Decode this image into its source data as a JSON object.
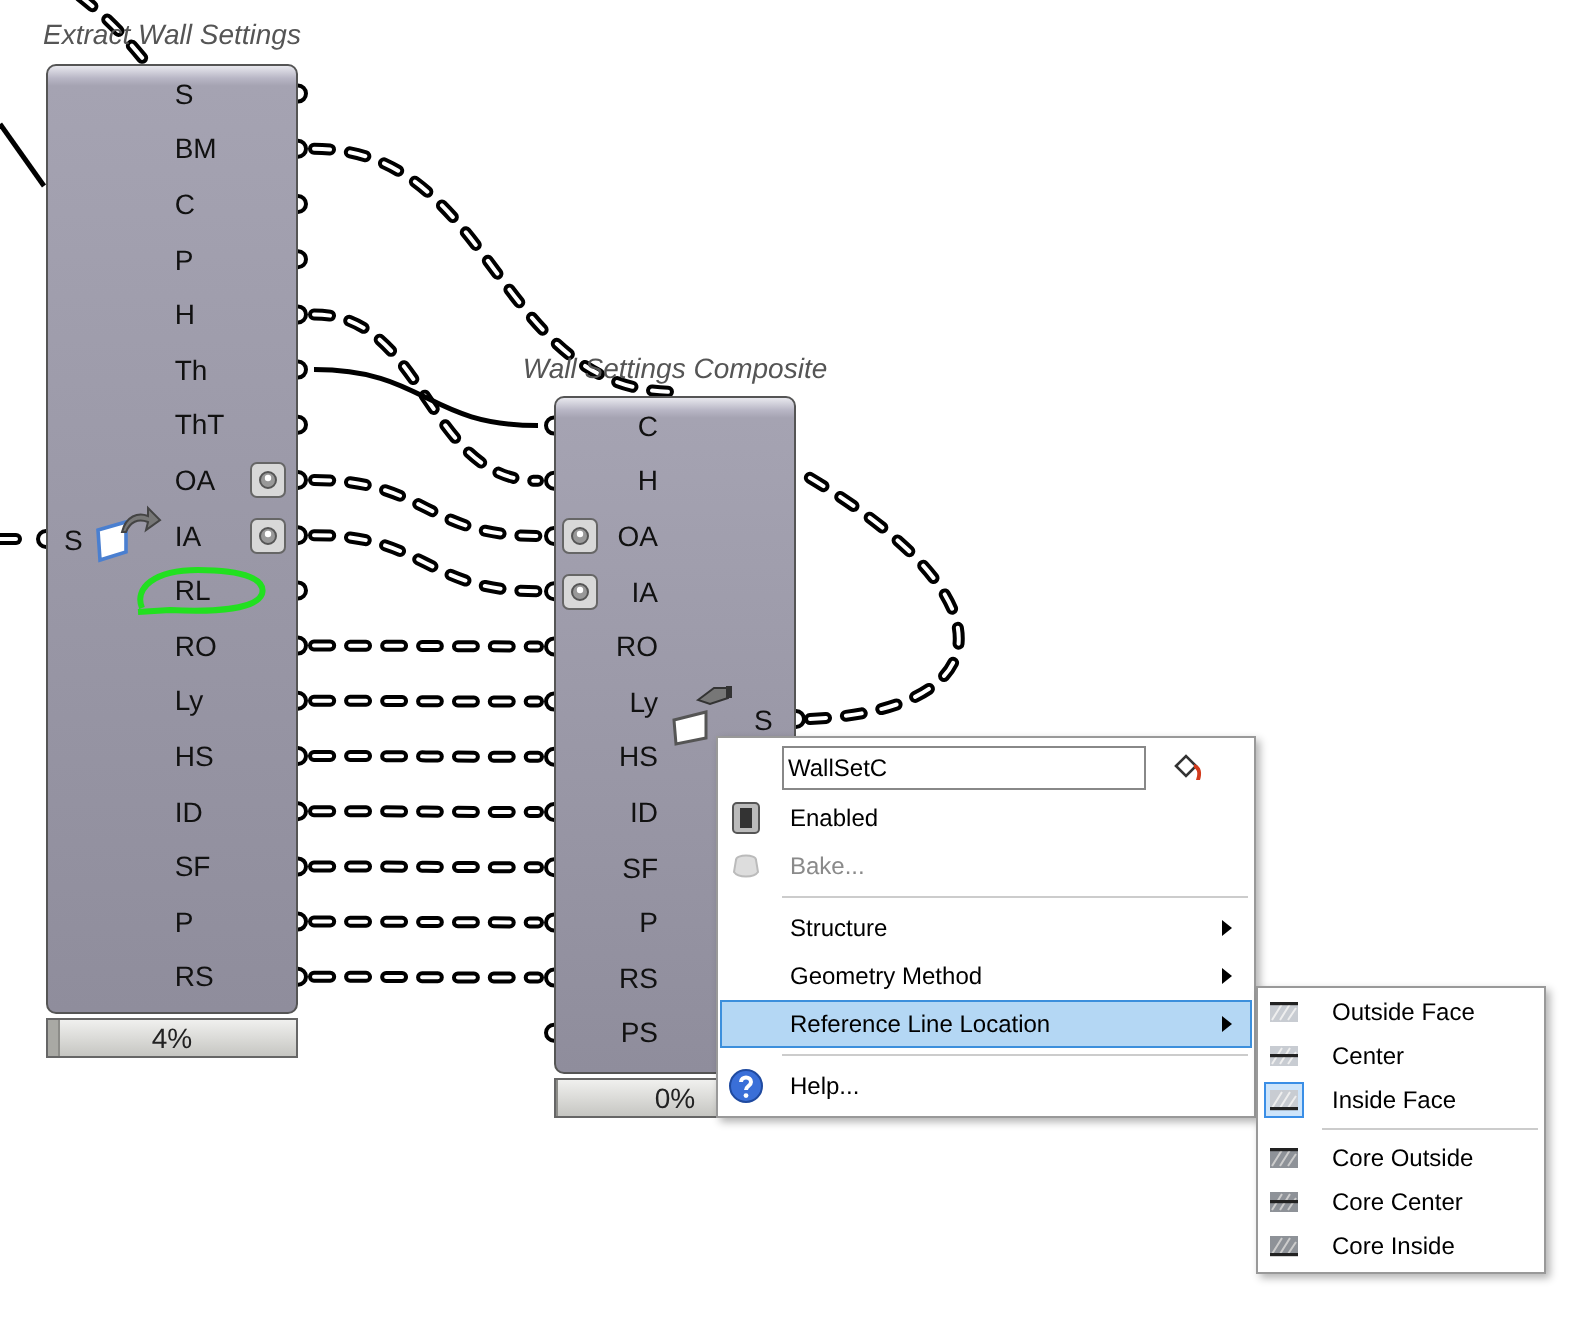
{
  "nodes": [
    {
      "title": "Extract Wall Settings",
      "inputs": [
        {
          "label": "S",
          "kind": "plain",
          "circled": false
        }
      ],
      "outputs": [
        {
          "label": "S",
          "kind": "plain",
          "circled": false
        },
        {
          "label": "BM",
          "kind": "plain",
          "circled": false
        },
        {
          "label": "C",
          "kind": "plain",
          "circled": false
        },
        {
          "label": "P",
          "kind": "plain",
          "circled": false
        },
        {
          "label": "H",
          "kind": "plain",
          "circled": false
        },
        {
          "label": "Th",
          "kind": "plain",
          "circled": false
        },
        {
          "label": "ThT",
          "kind": "plain",
          "circled": false
        },
        {
          "label": "OA",
          "kind": "toggle",
          "circled": false
        },
        {
          "label": "IA",
          "kind": "toggle",
          "circled": false
        },
        {
          "label": "RL",
          "kind": "plain",
          "circled": true
        },
        {
          "label": "RO",
          "kind": "plain",
          "circled": false
        },
        {
          "label": "Ly",
          "kind": "plain",
          "circled": false
        },
        {
          "label": "HS",
          "kind": "plain",
          "circled": false
        },
        {
          "label": "ID",
          "kind": "plain",
          "circled": false
        },
        {
          "label": "SF",
          "kind": "plain",
          "circled": false
        },
        {
          "label": "P",
          "kind": "plain",
          "circled": false
        },
        {
          "label": "RS",
          "kind": "plain",
          "circled": false
        }
      ],
      "progress": "4%",
      "level": 0.04
    },
    {
      "title": "Wall Settings Composite",
      "inputs": [
        {
          "label": "C",
          "kind": "plain",
          "circled": false
        },
        {
          "label": "H",
          "kind": "plain",
          "circled": false
        },
        {
          "label": "OA",
          "kind": "toggle",
          "circled": false
        },
        {
          "label": "IA",
          "kind": "toggle",
          "circled": false
        },
        {
          "label": "RO",
          "kind": "plain",
          "circled": false
        },
        {
          "label": "Ly",
          "kind": "plain",
          "circled": false
        },
        {
          "label": "HS",
          "kind": "plain",
          "circled": false
        },
        {
          "label": "ID",
          "kind": "plain",
          "circled": false
        },
        {
          "label": "SF",
          "kind": "plain",
          "circled": false
        },
        {
          "label": "P",
          "kind": "plain",
          "circled": false
        },
        {
          "label": "RS",
          "kind": "plain",
          "circled": false
        },
        {
          "label": "PS",
          "kind": "plain",
          "circled": false
        }
      ],
      "outputs": [
        {
          "label": "S",
          "kind": "plain",
          "circled": false
        }
      ],
      "progress": "0%",
      "level": 0
    }
  ],
  "context_menu": {
    "name_field": {
      "value": "WallSetC"
    },
    "groups": [
      [
        {
          "label": "Enabled",
          "disabled": false,
          "has_submenu": false,
          "selected": false
        },
        {
          "label": "Bake...",
          "disabled": true,
          "has_submenu": false,
          "selected": false
        }
      ],
      [
        {
          "label": "Structure",
          "disabled": false,
          "has_submenu": true,
          "selected": false
        },
        {
          "label": "Geometry Method",
          "disabled": false,
          "has_submenu": true,
          "selected": false
        },
        {
          "label": "Reference Line Location",
          "disabled": false,
          "has_submenu": true,
          "selected": true
        }
      ],
      [
        {
          "label": "Help...",
          "disabled": false,
          "has_submenu": false,
          "selected": false
        }
      ]
    ]
  },
  "submenu": {
    "groups": [
      [
        {
          "label": "Outside Face",
          "checked": false
        },
        {
          "label": "Center",
          "checked": false
        },
        {
          "label": "Inside Face",
          "checked": true
        }
      ],
      [
        {
          "label": "Core Outside",
          "checked": false
        },
        {
          "label": "Core Center",
          "checked": false
        },
        {
          "label": "Core Inside",
          "checked": false
        }
      ]
    ]
  }
}
